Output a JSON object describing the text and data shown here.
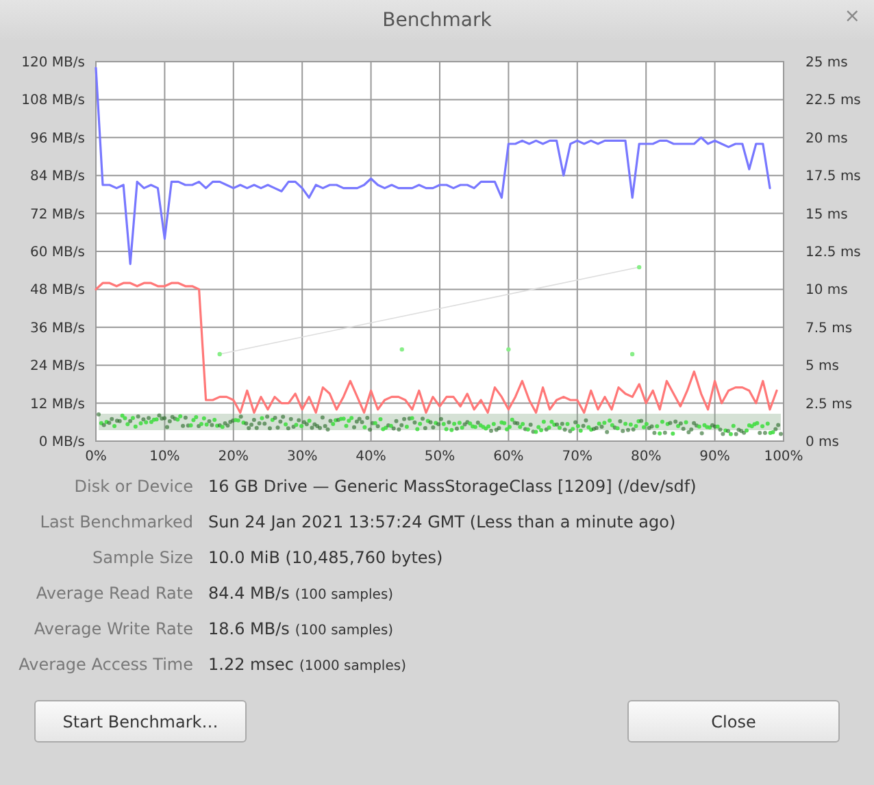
{
  "window": {
    "title": "Benchmark",
    "close_glyph": "×"
  },
  "chart_data": {
    "type": "line",
    "grid": true,
    "xlim": [
      0,
      100
    ],
    "ylim": [
      0,
      120
    ],
    "x": [
      0,
      1,
      2,
      3,
      4,
      5,
      6,
      7,
      8,
      9,
      10,
      11,
      12,
      13,
      14,
      15,
      16,
      17,
      18,
      19,
      20,
      21,
      22,
      23,
      24,
      25,
      26,
      27,
      28,
      29,
      30,
      31,
      32,
      33,
      34,
      35,
      36,
      37,
      38,
      39,
      40,
      41,
      42,
      43,
      44,
      45,
      46,
      47,
      48,
      49,
      50,
      51,
      52,
      53,
      54,
      55,
      56,
      57,
      58,
      59,
      60,
      61,
      62,
      63,
      64,
      65,
      66,
      67,
      68,
      69,
      70,
      71,
      72,
      73,
      74,
      75,
      76,
      77,
      78,
      79,
      80,
      81,
      82,
      83,
      84,
      85,
      86,
      87,
      88,
      89,
      90,
      91,
      92,
      93,
      94,
      95,
      96,
      97,
      98,
      99
    ],
    "xticks": [
      {
        "value": 0,
        "label": "0%"
      },
      {
        "value": 10,
        "label": "10%"
      },
      {
        "value": 20,
        "label": "20%"
      },
      {
        "value": 30,
        "label": "30%"
      },
      {
        "value": 40,
        "label": "40%"
      },
      {
        "value": 50,
        "label": "50%"
      },
      {
        "value": 60,
        "label": "60%"
      },
      {
        "value": 70,
        "label": "70%"
      },
      {
        "value": 80,
        "label": "80%"
      },
      {
        "value": 90,
        "label": "90%"
      },
      {
        "value": 100,
        "label": "100%"
      }
    ],
    "yticks": [
      {
        "value": 0,
        "label": "0 MB/s"
      },
      {
        "value": 12,
        "label": "12 MB/s"
      },
      {
        "value": 24,
        "label": "24 MB/s"
      },
      {
        "value": 36,
        "label": "36 MB/s"
      },
      {
        "value": 48,
        "label": "48 MB/s"
      },
      {
        "value": 60,
        "label": "60 MB/s"
      },
      {
        "value": 72,
        "label": "72 MB/s"
      },
      {
        "value": 84,
        "label": "84 MB/s"
      },
      {
        "value": 96,
        "label": "96 MB/s"
      },
      {
        "value": 108,
        "label": "108 MB/s"
      },
      {
        "value": 120,
        "label": "120 MB/s"
      }
    ],
    "y2ticks": [
      "0 ms",
      "2.5 ms",
      "5 ms",
      "7.5 ms",
      "10 ms",
      "12.5 ms",
      "15 ms",
      "17.5 ms",
      "20 ms",
      "22.5 ms",
      "25 ms"
    ],
    "series": [
      {
        "color": "#7777ff",
        "values": [
          118,
          81,
          81,
          80,
          81,
          56,
          82,
          80,
          81,
          80,
          64,
          82,
          82,
          81,
          81,
          82,
          80,
          82,
          82,
          81,
          80,
          81,
          80,
          81,
          80,
          81,
          80,
          79,
          82,
          82,
          80,
          77,
          81,
          80,
          81,
          81,
          80,
          80,
          80,
          81,
          83,
          81,
          80,
          81,
          80,
          80,
          80,
          81,
          80,
          80,
          81,
          81,
          80,
          81,
          81,
          80,
          82,
          82,
          82,
          77,
          94,
          94,
          95,
          94,
          95,
          94,
          95,
          95,
          84,
          94,
          95,
          94,
          95,
          94,
          95,
          95,
          95,
          95,
          77,
          94,
          94,
          94,
          95,
          95,
          94,
          94,
          94,
          94,
          96,
          94,
          95,
          94,
          93,
          94,
          94,
          86,
          94,
          94,
          80,
          null
        ]
      },
      {
        "color": "#ff7777",
        "values": [
          48,
          50,
          50,
          49,
          50,
          50,
          49,
          50,
          50,
          49,
          49,
          50,
          50,
          49,
          49,
          48,
          13,
          13,
          14,
          14,
          13,
          9,
          16,
          9,
          14,
          10,
          14,
          12,
          12,
          15,
          10,
          14,
          9,
          17,
          15,
          10,
          14,
          19,
          14,
          9,
          16,
          10,
          13,
          14,
          14,
          13,
          10,
          16,
          9,
          14,
          11,
          14,
          14,
          11,
          15,
          10,
          13,
          9,
          17,
          14,
          10,
          14,
          19,
          13,
          9,
          17,
          10,
          13,
          14,
          13,
          13,
          9,
          16,
          10,
          14,
          10,
          17,
          15,
          14,
          18,
          12,
          16,
          10,
          19,
          15,
          11,
          16,
          22,
          15,
          10,
          19,
          12,
          16,
          17,
          17,
          16,
          12,
          19,
          10,
          16
        ]
      }
    ]
  },
  "details": [
    {
      "label": "Disk or Device",
      "value": "16 GB Drive — Generic MassStorageClass [1209] (/dev/sdf)"
    },
    {
      "label": "Last Benchmarked",
      "value": "Sun 24 Jan 2021 13:57:24 GMT (Less than a minute ago)"
    },
    {
      "label": "Sample Size",
      "value": "10.0 MiB (10,485,760 bytes)"
    },
    {
      "label": "Average Read Rate",
      "value": "84.4 MB/s",
      "note": "(100 samples)"
    },
    {
      "label": "Average Write Rate",
      "value": "18.6 MB/s",
      "note": "(100 samples)"
    },
    {
      "label": "Average Access Time",
      "value": "1.22 msec",
      "note": "(1000 samples)"
    }
  ],
  "buttons": {
    "start": "Start Benchmark…",
    "close": "Close"
  }
}
